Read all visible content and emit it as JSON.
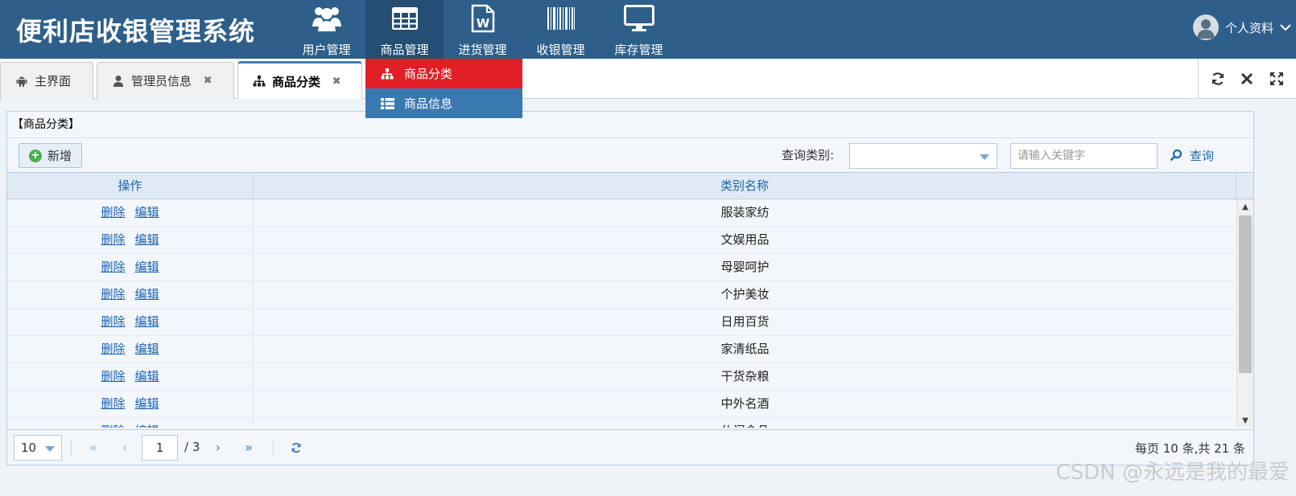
{
  "header": {
    "brand": "便利店收银管理系统",
    "nav": [
      {
        "label": "用户管理",
        "icon": "users-icon"
      },
      {
        "label": "商品管理",
        "icon": "table-icon"
      },
      {
        "label": "进货管理",
        "icon": "word-doc-icon"
      },
      {
        "label": "收银管理",
        "icon": "barcode-icon"
      },
      {
        "label": "库存管理",
        "icon": "monitor-icon"
      }
    ],
    "active_nav": "商品管理",
    "user_label": "个人资料"
  },
  "dropdown": {
    "items": [
      {
        "label": "商品分类",
        "icon": "sitemap-icon"
      },
      {
        "label": "商品信息",
        "icon": "list-icon"
      }
    ]
  },
  "tabs": [
    {
      "label": "主界面",
      "icon": "android-icon",
      "closable": false
    },
    {
      "label": "管理员信息",
      "icon": "user-icon",
      "closable": true
    },
    {
      "label": "商品分类",
      "icon": "sitemap-icon",
      "closable": true
    }
  ],
  "tab_close_glyph": "✖",
  "panel": {
    "title": "【商品分类】",
    "add_label": "新增",
    "query_label": "查询类别:",
    "query_select_value": "",
    "keyword_placeholder": "请输入关键字",
    "search_label": "查询"
  },
  "grid": {
    "columns": [
      "操作",
      "类别名称"
    ],
    "action_delete": "删除",
    "action_edit": "编辑",
    "rows": [
      {
        "name": "服装家纺"
      },
      {
        "name": "文娱用品"
      },
      {
        "name": "母婴呵护"
      },
      {
        "name": "个护美妆"
      },
      {
        "name": "日用百货"
      },
      {
        "name": "家清纸品"
      },
      {
        "name": "干货杂粮"
      },
      {
        "name": "中外名酒"
      },
      {
        "name": "休闲食品"
      }
    ]
  },
  "pager": {
    "page_size": "10",
    "current_page": "1",
    "total_pages": "/ 3",
    "info": "每页 10 条,共 21 条"
  },
  "watermark": "CSDN @永远是我的最爱",
  "colors": {
    "header_bg": "#2d5f8a",
    "dropdown_hover": "#e21f26",
    "dropdown_normal": "#3a78b0",
    "link": "#1a63b3"
  }
}
